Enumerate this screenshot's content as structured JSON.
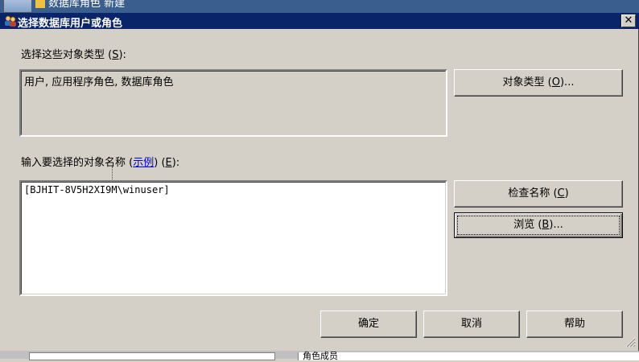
{
  "background": {
    "top_window_text": "数据库角色  新建",
    "bottom_pane_text": "角色成员"
  },
  "dialog": {
    "title": "选择数据库用户或角色",
    "close_glyph": "✕",
    "types_label_prefix": "选择这些对象类型 (",
    "types_label_key": "S",
    "types_label_suffix": "):",
    "types_value": "用户, 应用程序角色, 数据库角色",
    "object_types_button_prefix": "对象类型 (",
    "object_types_button_key": "O",
    "object_types_button_suffix": ")...",
    "names_label_prefix": "输入要选择的对象名称 (",
    "names_label_link": "示例",
    "names_label_mid": ") (",
    "names_label_key": "E",
    "names_label_suffix": "):",
    "names_value": "[BJHIT-8V5H2XI9M\\winuser]",
    "check_names_button_prefix": "检查名称 (",
    "check_names_button_key": "C",
    "check_names_button_suffix": ")",
    "browse_button_prefix": "浏览 (",
    "browse_button_key": "B",
    "browse_button_suffix": ")...",
    "ok_button": "确定",
    "cancel_button": "取消",
    "help_button": "帮助"
  },
  "colors": {
    "titlebar": "#0a246a",
    "dialog_face": "#d4d0c8",
    "link": "#0000ff"
  }
}
